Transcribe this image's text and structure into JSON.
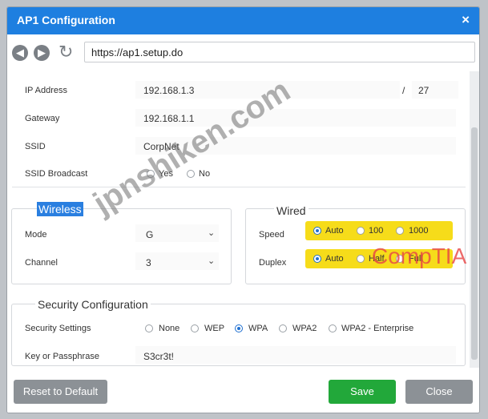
{
  "window": {
    "title": "AP1 Configuration",
    "close_glyph": "×"
  },
  "nav": {
    "back_icon": "back-arrow-icon",
    "forward_icon": "forward-arrow-icon",
    "refresh_icon": "refresh-icon",
    "url": "https://ap1.setup.do"
  },
  "network": {
    "ip_label": "IP Address",
    "ip_value": "192.168.1.3",
    "slash": "/",
    "prefix": "27",
    "gateway_label": "Gateway",
    "gateway_value": "192.168.1.1",
    "ssid_label": "SSID",
    "ssid_value": "CorpNet",
    "broadcast_label": "SSID Broadcast",
    "broadcast_yes": "Yes",
    "broadcast_no": "No"
  },
  "wireless": {
    "title": "Wireless",
    "mode_label": "Mode",
    "mode_value": "G",
    "channel_label": "Channel",
    "channel_value": "3"
  },
  "wired": {
    "title": "Wired",
    "speed_label": "Speed",
    "speed_options": [
      "Auto",
      "100",
      "1000"
    ],
    "speed_selected": "Auto",
    "duplex_label": "Duplex",
    "duplex_options": [
      "Auto",
      "Half",
      "Full"
    ],
    "duplex_selected": "Auto"
  },
  "security": {
    "title": "Security Configuration",
    "settings_label": "Security Settings",
    "options": [
      "None",
      "WEP",
      "WPA",
      "WPA2",
      "WPA2 - Enterprise"
    ],
    "selected": "WPA",
    "key_label": "Key or Passphrase",
    "key_value": "S3cr3t!"
  },
  "buttons": {
    "reset": "Reset to Default",
    "save": "Save",
    "close": "Close"
  },
  "watermarks": {
    "main": "jpnshiken.com",
    "brand": "CompTIA"
  },
  "colors": {
    "title_bar": "#1e7fe0",
    "save": "#22a83a",
    "gray_button": "#8c9196",
    "highlight": "#f6dc1a"
  }
}
